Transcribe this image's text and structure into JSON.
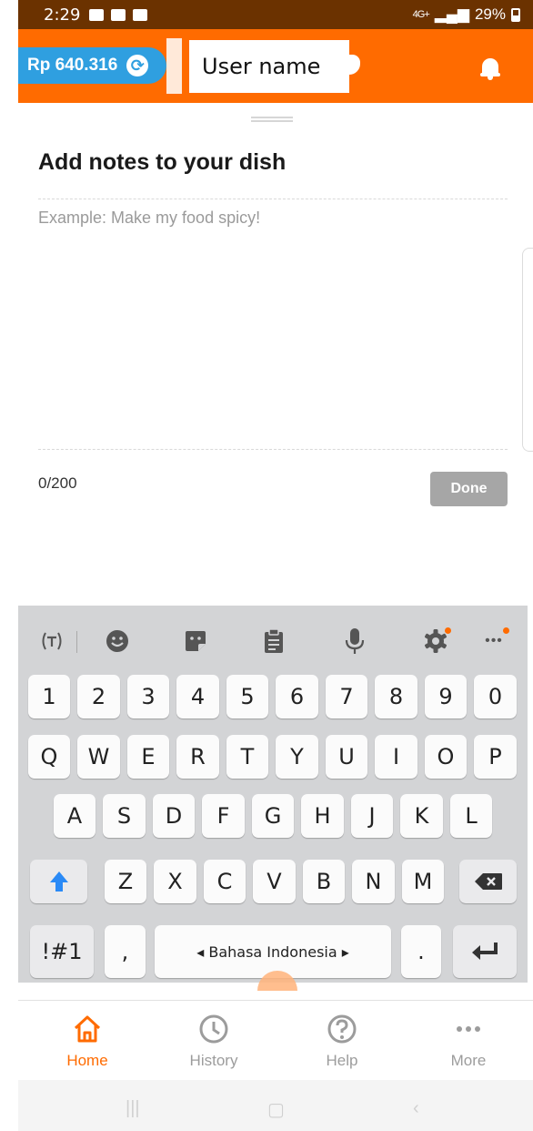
{
  "status_bar": {
    "time": "2:29",
    "network": "4G+",
    "battery": "29%",
    "icons": [
      "gallery-icon",
      "video-icon",
      "message-icon"
    ]
  },
  "header": {
    "balance": "Rp 640.316",
    "username": "User name",
    "colors": {
      "header_bg": "#ff6b00",
      "balance_pill": "#2f9fe0"
    }
  },
  "sheet": {
    "title": "Add notes to your dish",
    "note_value": "",
    "note_placeholder": "Example: Make my food spicy!",
    "char_count": "0/200",
    "done_label": "Done"
  },
  "keyboard": {
    "toolbar": [
      "text-style-icon",
      "emoji-icon",
      "sticker-icon",
      "clipboard-icon",
      "microphone-icon",
      "settings-icon",
      "more-icon"
    ],
    "rows": [
      [
        "1",
        "2",
        "3",
        "4",
        "5",
        "6",
        "7",
        "8",
        "9",
        "0"
      ],
      [
        "Q",
        "W",
        "E",
        "R",
        "T",
        "Y",
        "U",
        "I",
        "O",
        "P"
      ],
      [
        "A",
        "S",
        "D",
        "F",
        "G",
        "H",
        "J",
        "K",
        "L"
      ],
      [
        "Z",
        "X",
        "C",
        "V",
        "B",
        "N",
        "M"
      ]
    ],
    "symbols_label": "!#1",
    "comma": ",",
    "period": ".",
    "space_label": "◂ Bahasa Indonesia ▸"
  },
  "bottom_nav": {
    "items": [
      {
        "label": "Home",
        "icon": "home-icon",
        "active": true
      },
      {
        "label": "History",
        "icon": "clock-icon",
        "active": false
      },
      {
        "label": "Help",
        "icon": "help-icon",
        "active": false
      },
      {
        "label": "More",
        "icon": "more-dots-icon",
        "active": false
      }
    ],
    "active_color": "#ff6b00"
  }
}
